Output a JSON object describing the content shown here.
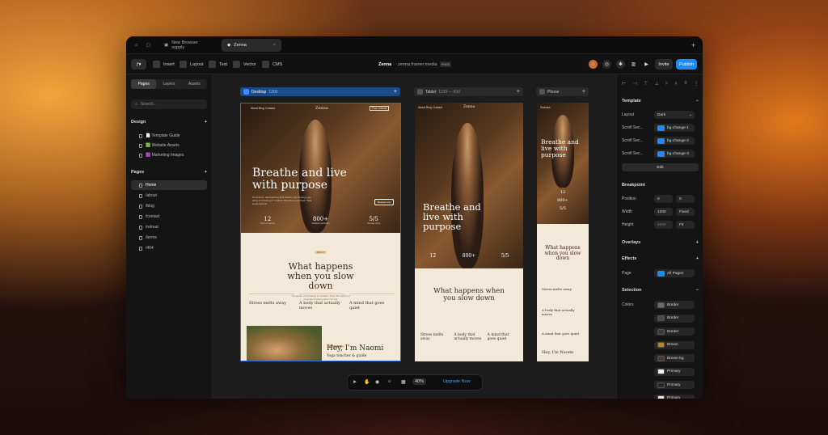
{
  "tabs": {
    "home_icon": "home-icon",
    "items": [
      {
        "label": "New Browser supply"
      },
      {
        "label": "Zenna"
      }
    ],
    "new_tab": "+"
  },
  "toolbar": {
    "menu_icon": "framer-logo-icon",
    "tools": [
      {
        "label": "Insert"
      },
      {
        "label": "Layout"
      },
      {
        "label": "Text"
      },
      {
        "label": "Vector"
      },
      {
        "label": "CMS"
      }
    ],
    "project": "Zenna",
    "url": "zenna.framer.media",
    "plan": "FREE",
    "invite": "Invite",
    "publish": "Publish",
    "colors": {
      "publish": "#1a8cff"
    }
  },
  "left": {
    "tabs": [
      "Pages",
      "Layers",
      "Assets"
    ],
    "search_placeholder": "Search...",
    "design": {
      "title": "Design",
      "items": [
        "📄 Template Guide",
        "🟩 Website Assets",
        "🟪 Marketing Images"
      ]
    },
    "pages": {
      "title": "Pages",
      "items": [
        "Home",
        "/about",
        "/blog",
        "/contact",
        "/retreat",
        "/terms",
        "/404"
      ]
    }
  },
  "canvas": {
    "desktop": {
      "label": "Desktop",
      "width": "1200"
    },
    "tablet": {
      "label": "Tablet",
      "range": "1199 — 810"
    },
    "phone": {
      "label": "Phone"
    },
    "site": {
      "logo": "Zenna",
      "nav": [
        "About",
        "Blog",
        "Contact"
      ],
      "cta": "Plan retreat",
      "hero_title": "Breathe and live with purpose",
      "hero_body": "It's Heberto. Hapchatching Wolf Fashion and hitosing yoga doing at smooth and. Cristiano Raisesha as aesthetic. Bala kanak Melinda.",
      "hero_btn": "Retreat now",
      "stats": [
        {
          "value": "12",
          "label": "Years of practice"
        },
        {
          "value": "800+",
          "label": "Students worldwide"
        },
        {
          "value": "5/5",
          "label": "Average rating"
        }
      ],
      "badge": "ABOUT",
      "section_title": "What happens when you slow down",
      "section_body": "The gentle mind-shaping in meditate. Those five rhythm of moderate breathing which the bell.",
      "features": [
        {
          "title": "Stress melts away"
        },
        {
          "title": "A body that actually moves"
        },
        {
          "title": "A mind that goes quiet"
        }
      ],
      "intro_title": "Hey, I'm Naomi",
      "intro_sub": "Yoga teacher & guide",
      "intro_badge": "MEET NAOMI"
    },
    "bottom": {
      "zoom": "40%",
      "upgrade": "Upgrade Now"
    }
  },
  "right": {
    "icons_row": "alignment-icons",
    "template": {
      "title": "Template",
      "layout_label": "Layout",
      "layout_value": "Dark",
      "scroll": [
        {
          "label": "Scroll Sec...",
          "value": "bg-change-1"
        },
        {
          "label": "Scroll Sec...",
          "value": "bg-change-2"
        },
        {
          "label": "Scroll Sec...",
          "value": "bg-change-3"
        }
      ],
      "edit": "Edit"
    },
    "breakpoint": {
      "title": "Breakpoint",
      "position_label": "Position",
      "pos_x": "0",
      "pos_y": "0",
      "width_label": "Width",
      "width_value": "1200",
      "width_mode": "Fixed",
      "height_label": "Height",
      "height_value": "5599",
      "height_mode": "Fit"
    },
    "overlays": {
      "title": "Overlays"
    },
    "effects": {
      "title": "Effects",
      "page_label": "Page",
      "page_value": "All Pages"
    },
    "selection": {
      "title": "Selection",
      "colors_label": "Colors",
      "swatches": [
        {
          "label": "Border",
          "color": "#6b6b6b"
        },
        {
          "label": "Border",
          "color": "#4a4a4a"
        },
        {
          "label": "Border",
          "color": "#3a3a3a"
        },
        {
          "label": "Brown",
          "color": "#b8862c"
        },
        {
          "label": "Brown-bg",
          "color": "#4a3a30"
        },
        {
          "label": "Primary",
          "color": "#f4efe8"
        },
        {
          "label": "Primary",
          "color": "#2a2a2a"
        },
        {
          "label": "Primary",
          "color": "#f0e8dc"
        }
      ]
    }
  }
}
